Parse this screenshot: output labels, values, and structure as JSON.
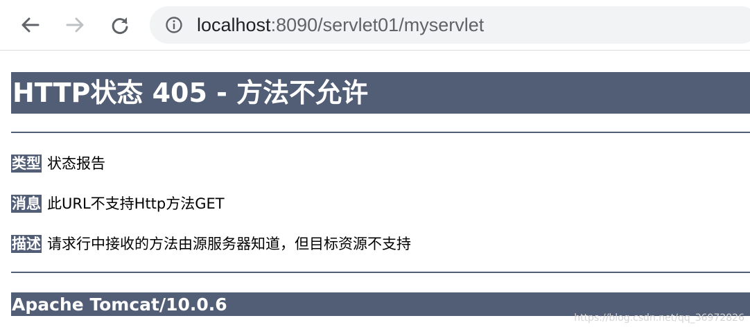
{
  "browser": {
    "url_host": "localhost",
    "url_rest": ":8090/servlet01/myservlet",
    "icons": {
      "back": "arrow-left-icon",
      "forward": "arrow-right-icon",
      "reload": "reload-icon",
      "site_info": "info-circle-icon"
    }
  },
  "page": {
    "title": "HTTP状态 405 - 方法不允许",
    "rows": [
      {
        "label": "类型",
        "value": "状态报告"
      },
      {
        "label": "消息",
        "value": "此URL不支持Http方法GET"
      },
      {
        "label": "描述",
        "value": "请求行中接收的方法由源服务器知道，但目标资源不支持"
      }
    ],
    "footer": "Apache Tomcat/10.0.6",
    "watermark": "https://blog.csdn.net/qq_36972826"
  },
  "colors": {
    "accent": "#525d76",
    "address_bar_bg": "#f1f3f4"
  }
}
